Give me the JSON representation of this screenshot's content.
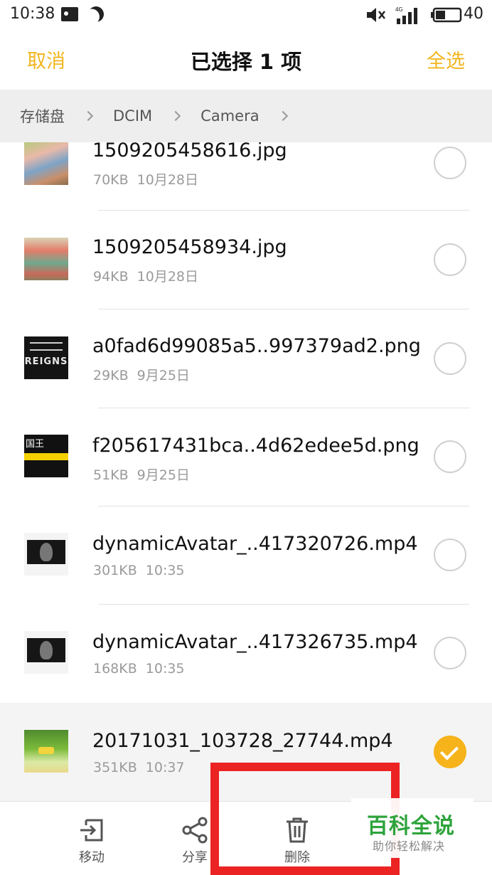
{
  "status_bar": {
    "time": "10:38",
    "network": "4G",
    "battery_level": "40",
    "battery_fraction": 0.4,
    "icons": [
      "image-icon",
      "moon-icon",
      "mute-icon",
      "signal-icon",
      "battery-icon"
    ]
  },
  "header": {
    "cancel_label": "取消",
    "title": "已选择 1 项",
    "select_all_label": "全选",
    "accent_color": "#f2b51d"
  },
  "breadcrumb": {
    "items": [
      "存储盘",
      "DCIM",
      "Camera"
    ]
  },
  "files": [
    {
      "name": "1509205458616.jpg",
      "size": "70KB",
      "date": "10月28日",
      "selected": false,
      "thumb": "rock-painting-thumbnail"
    },
    {
      "name": "1509205458934.jpg",
      "size": "94KB",
      "date": "10月28日",
      "selected": false,
      "thumb": "rock-painting-thumbnail"
    },
    {
      "name": "a0fad6d99085a5..997379ad2.png",
      "size": "29KB",
      "date": "9月25日",
      "selected": false,
      "thumb": "reigns-thumbnail"
    },
    {
      "name": "f205617431bca..4d62edee5d.png",
      "size": "51KB",
      "date": "9月25日",
      "selected": false,
      "thumb": "king-game-thumbnail"
    },
    {
      "name": "dynamicAvatar_..417320726.mp4",
      "size": "301KB",
      "date": "10:35",
      "selected": false,
      "thumb": "avatar-video-thumbnail"
    },
    {
      "name": "dynamicAvatar_..417326735.mp4",
      "size": "168KB",
      "date": "10:35",
      "selected": false,
      "thumb": "avatar-video-thumbnail"
    },
    {
      "name": "20171031_103728_27744.mp4",
      "size": "351KB",
      "date": "10:37",
      "selected": true,
      "thumb": "game-video-thumbnail"
    }
  ],
  "thumb_text": {
    "reigns": "REIGNS",
    "king": "国王"
  },
  "actions": {
    "move_label": "移动",
    "share_label": "分享",
    "delete_label": "删除"
  },
  "watermark": {
    "title": "百科全说",
    "subtitle": "助你轻松解决"
  },
  "colors": {
    "check_selected": "#f6b31a",
    "highlight_box": "#ec2323",
    "watermark_green": "#2ea43c"
  }
}
